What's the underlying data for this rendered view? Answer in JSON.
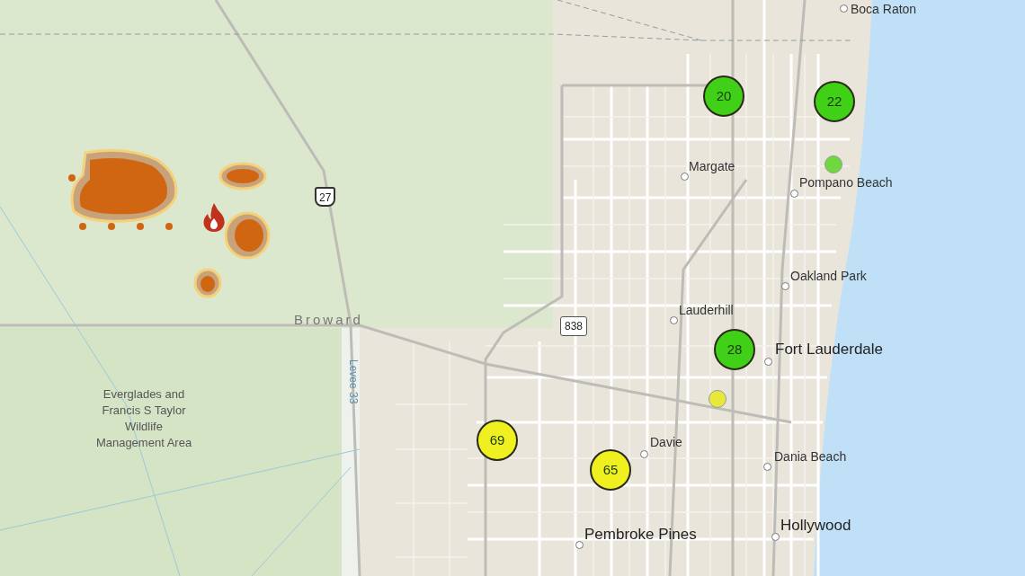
{
  "map": {
    "places": [
      {
        "name": "Boca Raton",
        "kind": "city"
      },
      {
        "name": "Margate",
        "kind": "city"
      },
      {
        "name": "Pompano Beach",
        "kind": "city"
      },
      {
        "name": "Oakland Park",
        "kind": "city"
      },
      {
        "name": "Lauderhill",
        "kind": "city"
      },
      {
        "name": "Fort Lauderdale",
        "kind": "major-city"
      },
      {
        "name": "Davie",
        "kind": "city"
      },
      {
        "name": "Dania Beach",
        "kind": "city"
      },
      {
        "name": "Hollywood",
        "kind": "major-city"
      },
      {
        "name": "Pembroke Pines",
        "kind": "major-city"
      }
    ],
    "region_labels": [
      {
        "text": "Broward",
        "kind": "county"
      },
      {
        "text": "Everglades and Francis S Taylor Wildlife Management Area",
        "kind": "area"
      },
      {
        "text": "Levee 33",
        "kind": "waterway"
      }
    ],
    "road_shields": [
      {
        "label": "27",
        "kind": "us-highway"
      },
      {
        "label": "838",
        "kind": "state-road"
      }
    ],
    "markers": [
      {
        "label": "20",
        "color": "#3fd017",
        "kind": "cluster"
      },
      {
        "label": "22",
        "color": "#3fd017",
        "kind": "cluster"
      },
      {
        "color": "#6fd83f",
        "kind": "dot"
      },
      {
        "label": "28",
        "color": "#3fd017",
        "kind": "cluster"
      },
      {
        "color": "#e8e83a",
        "kind": "dot"
      },
      {
        "label": "69",
        "color": "#f0f020",
        "kind": "cluster"
      },
      {
        "label": "65",
        "color": "#f0f020",
        "kind": "cluster"
      }
    ]
  }
}
